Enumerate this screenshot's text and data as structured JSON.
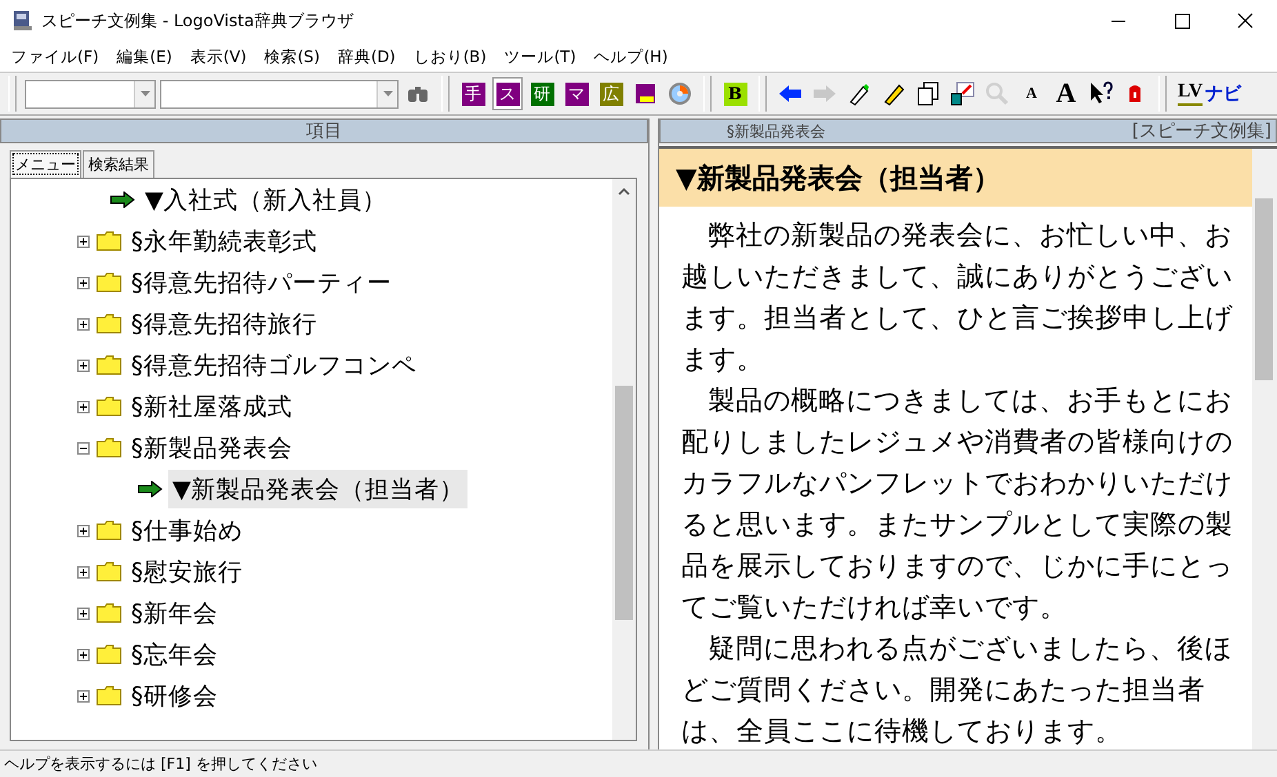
{
  "window": {
    "title": "スピーチ文例集 - LogoVista辞典ブラウザ"
  },
  "menu": [
    "ファイル(F)",
    "編集(E)",
    "表示(V)",
    "検索(S)",
    "辞典(D)",
    "しおり(B)",
    "ツール(T)",
    "ヘルプ(H)"
  ],
  "toolbar": [
    [
      {
        "kind": "combo"
      },
      {
        "kind": "wide-combo"
      },
      {
        "kind": "binoculars",
        "disabled": false
      }
    ],
    [
      {
        "kind": "glyph",
        "text": "手",
        "color": "#800080",
        "selected": false
      },
      {
        "kind": "glyph",
        "text": "ス",
        "color": "#800080",
        "selected": true
      },
      {
        "kind": "glyph",
        "text": "研",
        "color": "#007000",
        "selected": false
      },
      {
        "kind": "glyph",
        "text": "マ",
        "color": "#800080",
        "selected": false
      },
      {
        "kind": "glyph",
        "text": "広",
        "color": "#808000",
        "selected": false
      },
      {
        "kind": "book"
      },
      {
        "kind": "disc"
      }
    ],
    [
      {
        "kind": "glyph",
        "text": "B",
        "color": "#9be000",
        "selected": false
      }
    ],
    [
      {
        "kind": "back",
        "disabled": false
      },
      {
        "kind": "forward",
        "disabled": true
      },
      {
        "kind": "marker"
      },
      {
        "kind": "pencil"
      },
      {
        "kind": "pages"
      },
      {
        "kind": "window"
      },
      {
        "kind": "zoom",
        "disabled": true
      },
      {
        "kind": "small-a",
        "text": "A"
      },
      {
        "kind": "large-a",
        "text": "A"
      },
      {
        "kind": "help"
      },
      {
        "kind": "bookmark"
      }
    ],
    [
      {
        "kind": "navi",
        "text": "LV",
        "suffix": "ナビ"
      }
    ]
  ],
  "left_panel": {
    "title": "項目",
    "tabs": [
      {
        "label": "メニュー",
        "selected": true
      },
      {
        "label": "検索結果",
        "selected": false
      }
    ],
    "tree": [
      {
        "kind": "leaf",
        "label": "▼入社式（新入社員）",
        "selected": false
      },
      {
        "kind": "folder",
        "label": "§永年勤続表彰式",
        "expanded": false
      },
      {
        "kind": "folder",
        "label": "§得意先招待パーティー",
        "expanded": false
      },
      {
        "kind": "folder",
        "label": "§得意先招待旅行",
        "expanded": false
      },
      {
        "kind": "folder",
        "label": "§得意先招待ゴルフコンペ",
        "expanded": false
      },
      {
        "kind": "folder",
        "label": "§新社屋落成式",
        "expanded": false
      },
      {
        "kind": "folder",
        "label": "§新製品発表会",
        "expanded": true,
        "children": [
          {
            "kind": "leaf",
            "label": "▼新製品発表会（担当者）",
            "selected": true
          }
        ]
      },
      {
        "kind": "folder",
        "label": "§仕事始め",
        "expanded": false
      },
      {
        "kind": "folder",
        "label": "§慰安旅行",
        "expanded": false
      },
      {
        "kind": "folder",
        "label": "§新年会",
        "expanded": false
      },
      {
        "kind": "folder",
        "label": "§忘年会",
        "expanded": false
      },
      {
        "kind": "folder",
        "label": "§研修会",
        "expanded": false
      }
    ]
  },
  "right_panel": {
    "section": "§新製品発表会",
    "dictionary": "[スピーチ文例集]",
    "heading": "▼新製品発表会（担当者）",
    "paragraphs": [
      "弊社の新製品の発表会に、お忙しい中、お越しいただきまして、誠にありがとうございます。担当者として、ひと言ご挨拶申し上げます。",
      "製品の概略につきましては、お手もとにお配りしましたレジュメや消費者の皆様向けのカラフルなパンフレットでおわかりいただけると思います。またサンプルとして実際の製品を展示しておりますので、じかに手にとってご覧いただければ幸いです。",
      "疑問に思われる点がございましたら、後ほどご質問ください。開発にあたった担当者は、全員ここに待機しております。"
    ]
  },
  "status_bar": "ヘルプを表示するには [F1] を押してください"
}
